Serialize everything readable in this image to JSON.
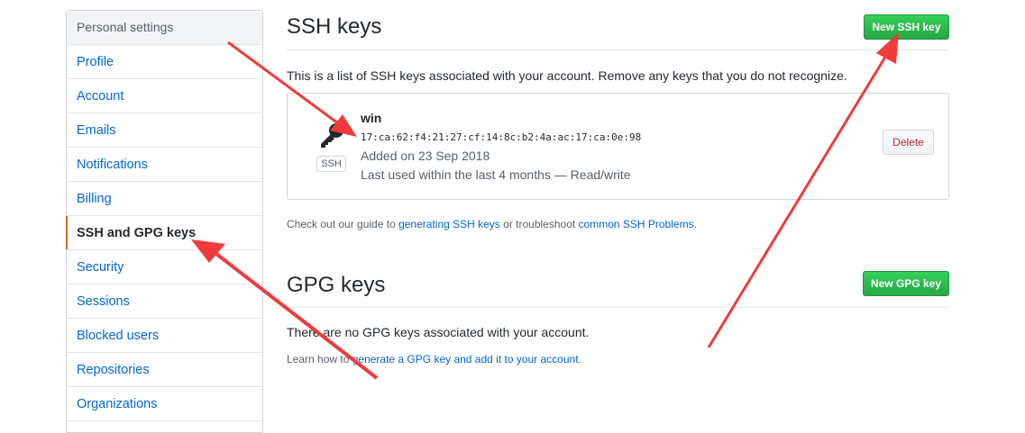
{
  "sidebar": {
    "header": "Personal settings",
    "items": [
      {
        "label": "Profile"
      },
      {
        "label": "Account"
      },
      {
        "label": "Emails"
      },
      {
        "label": "Notifications"
      },
      {
        "label": "Billing"
      },
      {
        "label": "SSH and GPG keys"
      },
      {
        "label": "Security"
      },
      {
        "label": "Sessions"
      },
      {
        "label": "Blocked users"
      },
      {
        "label": "Repositories"
      },
      {
        "label": "Organizations"
      }
    ],
    "selected_label": "SSH and GPG keys"
  },
  "ssh": {
    "title": "SSH keys",
    "new_button": "New SSH key",
    "description": "This is a list of SSH keys associated with your account. Remove any keys that you do not recognize.",
    "key": {
      "title": "win",
      "fingerprint": "17:ca:62:f4:21:27:cf:14:8c:b2:4a:ac:17:ca:0e:98",
      "added": "Added on 23 Sep 2018",
      "last_used": "Last used within the last 4 months — Read/write",
      "badge": "SSH",
      "delete_button": "Delete"
    },
    "guide": {
      "prefix": "Check out our guide to ",
      "link1": "generating SSH keys",
      "middle": " or troubleshoot ",
      "link2": "common SSH Problems",
      "suffix": "."
    }
  },
  "gpg": {
    "title": "GPG keys",
    "new_button": "New GPG key",
    "empty_text": "There are no GPG keys associated with your account.",
    "learn": {
      "prefix": "Learn how to ",
      "link": "generate a GPG key and add it to your account",
      "suffix": "."
    }
  },
  "colors": {
    "accent_selected": "#e36209",
    "link": "#0366d6",
    "green_button": "#28a745",
    "danger": "#cb2431",
    "annotation_arrow": "#ef3b3b"
  }
}
